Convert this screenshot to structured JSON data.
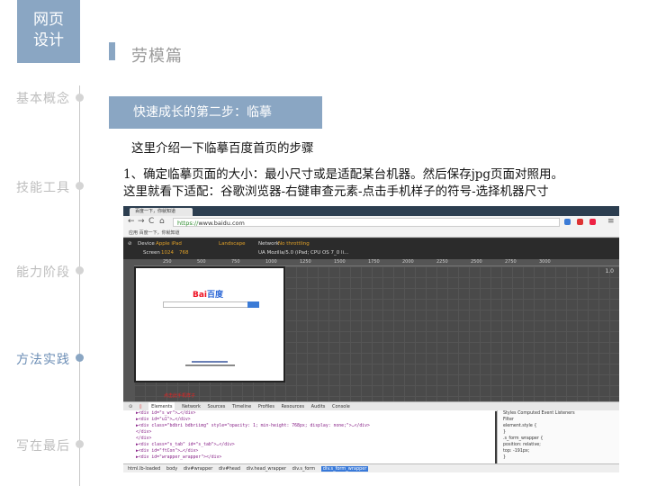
{
  "sidebar": {
    "logo": [
      "网页",
      "设计"
    ],
    "items": [
      {
        "label": "基本概念",
        "active": false
      },
      {
        "label": "技能工具",
        "active": false
      },
      {
        "label": "能力阶段",
        "active": false
      },
      {
        "label": "方法实践",
        "active": true
      },
      {
        "label": "写在最后",
        "active": false
      }
    ]
  },
  "header": {
    "title": "劳模篇"
  },
  "content": {
    "step": "快速成长的第二步：临摹",
    "intro": "这里介绍一下临摹百度首页的步骤",
    "desc_line1": "1、确定临摹页面的大小：最小尺寸或是适配某台机器。然后保存jpg页面对照用。",
    "desc_line2": "这里就看下适配：谷歌浏览器-右键审查元素-点击手机样子的符号-选择机器尺寸"
  },
  "browser": {
    "tab_title": "百度一下，你就知道",
    "url_scheme": "https://",
    "url_host": "www.baidu.com",
    "bookmark": "应用  百度一下，你就知道",
    "emulation": {
      "device_label": "Device",
      "device_value": "Apple iPad",
      "landscape": "Landscape",
      "screen_label": "Screen",
      "screen_w": "1024",
      "screen_h": "768",
      "network_label": "Network",
      "network_value": "No throttling",
      "ua": "UA  Mozilla/5.0 (iPad; CPU OS 7_0 li..."
    },
    "ruler_ticks": [
      "250",
      "500",
      "750",
      "1000",
      "1250",
      "1500",
      "1750",
      "2000",
      "2250",
      "2500",
      "2750",
      "3000"
    ],
    "zoom": "1.0",
    "baidu_logo": [
      "Bai",
      "百度"
    ],
    "devtools_tabs": [
      "Elements",
      "Network",
      "Sources",
      "Timeline",
      "Profiles",
      "Resources",
      "Audits",
      "Console"
    ],
    "tip": "点击此手机样子",
    "code_lines": [
      "▶<div id=\"s_wr\">…</div>",
      "▶<div id=\"u1\">…</div>",
      "▶<div class=\"bdbri bdbriimg\" style=\"opacity: 1; min-height: 768px; display: none;\">…</div>",
      "</div>",
      "</div>",
      "▶<div class=\"s_tab\" id=\"s_tab\">…</div>",
      "▶<div id=\"ftCon\">…</div>",
      "▶<div id=\"wrapper_wrapper\"></div>"
    ],
    "styles_tabs": "Styles  Computed  Event Listeners",
    "styles_lines": [
      "Filter",
      "element.style {",
      "}",
      ".s_form_wrapper {",
      "  position: relative;",
      "  top: -191px;",
      "}"
    ],
    "crumbs": [
      "html.lb-loaded",
      "body",
      "div#wrapper",
      "div#head",
      "div.head_wrapper",
      "div.s_form",
      "div.s_form_wrapper"
    ]
  },
  "colors": {
    "accent": "#8aa6c3",
    "active_text": "#6b8db5",
    "muted": "#bdbdbd"
  }
}
